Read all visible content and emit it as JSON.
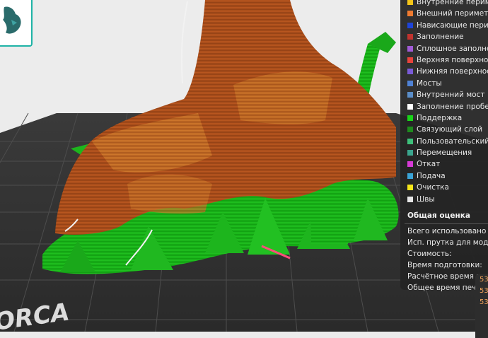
{
  "legend": {
    "items": [
      {
        "label": "Внутренние периметры",
        "color": "#f5c518"
      },
      {
        "label": "Внешний периметр",
        "color": "#f07b30"
      },
      {
        "label": "Нависающие периметры",
        "color": "#1e44d8"
      },
      {
        "label": "Заполнение",
        "color": "#c0332e"
      },
      {
        "label": "Сплошное заполнение",
        "color": "#a05bd6"
      },
      {
        "label": "Верхняя поверхность",
        "color": "#e8433c"
      },
      {
        "label": "Нижняя поверхность",
        "color": "#7a5bd8"
      },
      {
        "label": "Мосты",
        "color": "#4f82d6"
      },
      {
        "label": "Внутренний мост",
        "color": "#5a8dc8"
      },
      {
        "label": "Заполнение пробелов",
        "color": "#ffffff"
      },
      {
        "label": "Поддержка",
        "color": "#19d419"
      },
      {
        "label": "Связующий слой",
        "color": "#1e8a1e"
      },
      {
        "label": "Пользовательский",
        "color": "#3dbf7a"
      },
      {
        "label": "Перемещения",
        "color": "#3aa58e"
      },
      {
        "label": "Откат",
        "color": "#d63ad6"
      },
      {
        "label": "Подача",
        "color": "#3aa3d6"
      },
      {
        "label": "Очистка",
        "color": "#f5e51a"
      },
      {
        "label": "Швы",
        "color": "#e6e6e6"
      }
    ]
  },
  "estimate": {
    "title": "Общая оценка",
    "rows": [
      "Всего использовано прутка",
      "Исп. прутка для моделей",
      "Стоимость:",
      "Время подготовки:",
      "Расчётное время печати",
      "Общее время печати:"
    ]
  },
  "mini_panel": {
    "values": [
      "53",
      "53",
      "53"
    ]
  },
  "bed_label": "ORCA"
}
